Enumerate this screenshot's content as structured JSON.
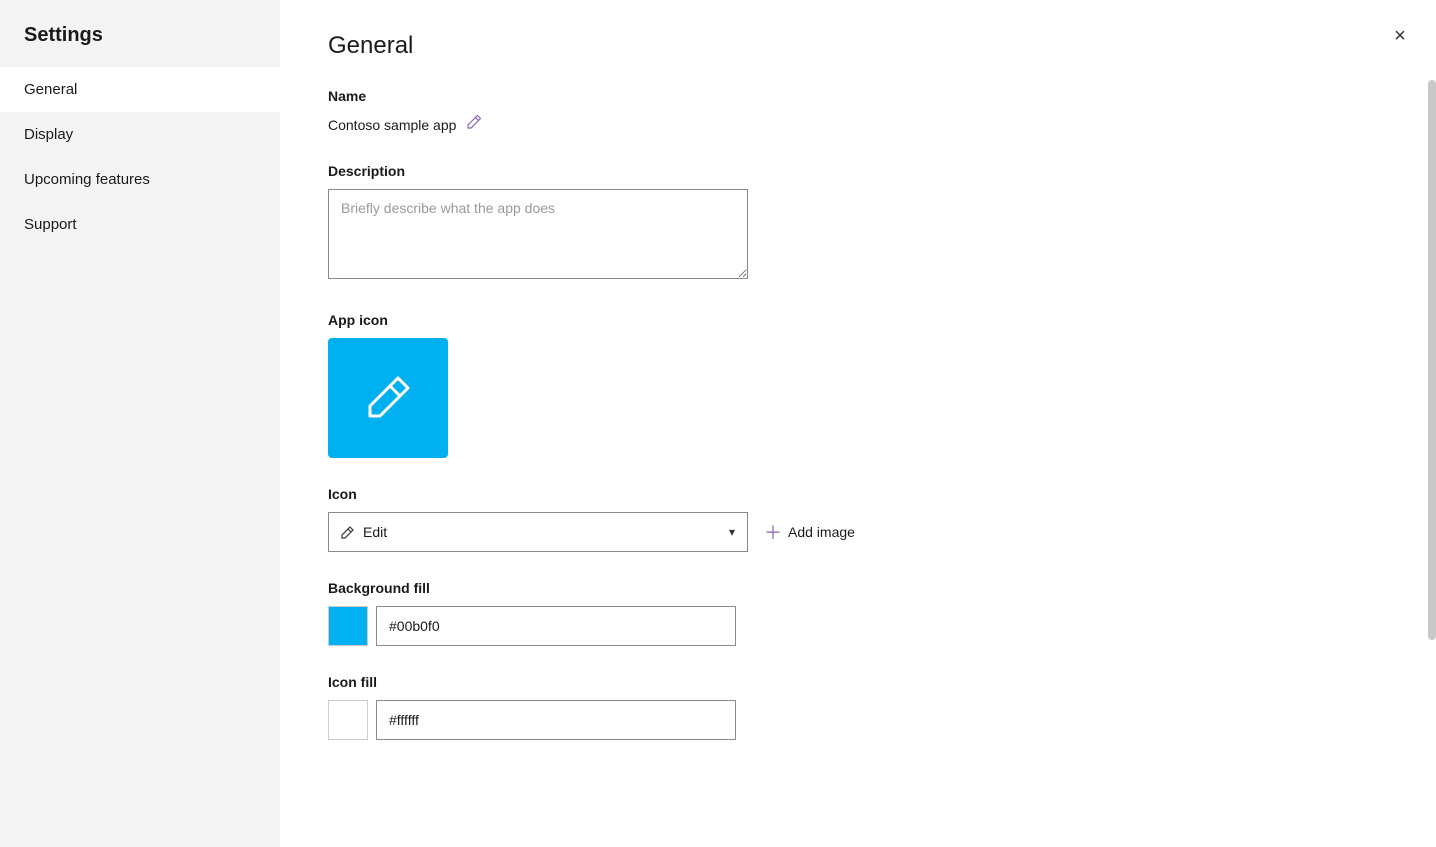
{
  "sidebar": {
    "title": "Settings",
    "nav_items": [
      {
        "label": "General",
        "active": true
      },
      {
        "label": "Display",
        "active": false
      },
      {
        "label": "Upcoming features",
        "active": false
      },
      {
        "label": "Support",
        "active": false
      }
    ]
  },
  "main": {
    "page_title": "General",
    "close_button_label": "×",
    "name_section": {
      "label": "Name",
      "value": "Contoso sample app",
      "edit_icon": "✏"
    },
    "description_section": {
      "label": "Description",
      "placeholder": "Briefly describe what the app does"
    },
    "app_icon_section": {
      "label": "App icon",
      "icon_bg_color": "#00b0f0"
    },
    "icon_section": {
      "label": "Icon",
      "selected": "Edit",
      "add_image_label": "Add image"
    },
    "background_fill_section": {
      "label": "Background fill",
      "color": "#00b0f0",
      "color_value": "#00b0f0"
    },
    "icon_fill_section": {
      "label": "Icon fill",
      "color": "#ffffff",
      "color_value": "#ffffff"
    }
  }
}
